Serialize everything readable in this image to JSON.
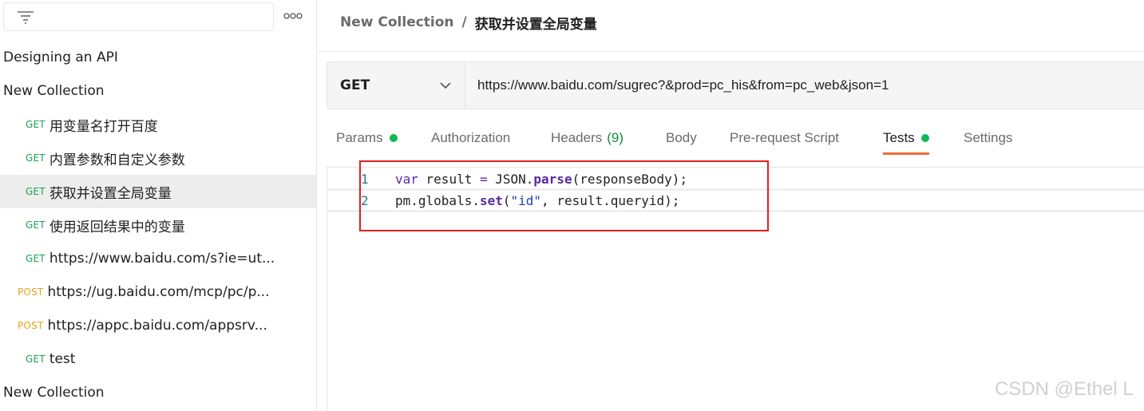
{
  "sidebar": {
    "filter_placeholder": "",
    "items": [
      {
        "kind": "collection",
        "name": "Designing an API"
      },
      {
        "kind": "collection",
        "name": "New Collection"
      },
      {
        "kind": "request",
        "method": "GET",
        "name": "用变量名打开百度"
      },
      {
        "kind": "request",
        "method": "GET",
        "name": "内置参数和自定义参数"
      },
      {
        "kind": "request",
        "method": "GET",
        "name": "获取并设置全局变量",
        "selected": true
      },
      {
        "kind": "request",
        "method": "GET",
        "name": "使用返回结果中的变量"
      },
      {
        "kind": "request",
        "method": "GET",
        "name": "https://www.baidu.com/s?ie=ut..."
      },
      {
        "kind": "request",
        "method": "POST",
        "name": "https://ug.baidu.com/mcp/pc/p..."
      },
      {
        "kind": "request",
        "method": "POST",
        "name": "https://appc.baidu.com/appsrv..."
      },
      {
        "kind": "request",
        "method": "GET",
        "name": "test"
      },
      {
        "kind": "collection",
        "name": "New Collection"
      }
    ]
  },
  "breadcrumb": {
    "collection": "New Collection",
    "separator": "/",
    "request": "获取并设置全局变量"
  },
  "request": {
    "method": "GET",
    "url": "https://www.baidu.com/sugrec?&prod=pc_his&from=pc_web&json=1"
  },
  "tabs": [
    {
      "label": "Params",
      "dot": true
    },
    {
      "label": "Authorization"
    },
    {
      "label": "Headers",
      "count": "(9)"
    },
    {
      "label": "Body"
    },
    {
      "label": "Pre-request Script"
    },
    {
      "label": "Tests",
      "dot": true,
      "active": true
    },
    {
      "label": "Settings"
    }
  ],
  "editor": {
    "line_numbers": [
      "1",
      "2"
    ],
    "line1": {
      "t1": "var",
      "t2": " result ",
      "t3": "=",
      "t4": " JSON.",
      "t5": "parse",
      "t6": "(responseBody);"
    },
    "line2": {
      "t1": "pm.globals.",
      "t2": "set",
      "t3": "(",
      "t4": "\"id\"",
      "t5": ", result.queryid);"
    }
  },
  "watermark": "CSDN @Ethel L",
  "colors": {
    "get": "#1aa453",
    "post": "#e8a317",
    "tab_accent": "#f26b3a",
    "status_dot": "#0cbb52",
    "highlight_box": "#e0201c"
  }
}
